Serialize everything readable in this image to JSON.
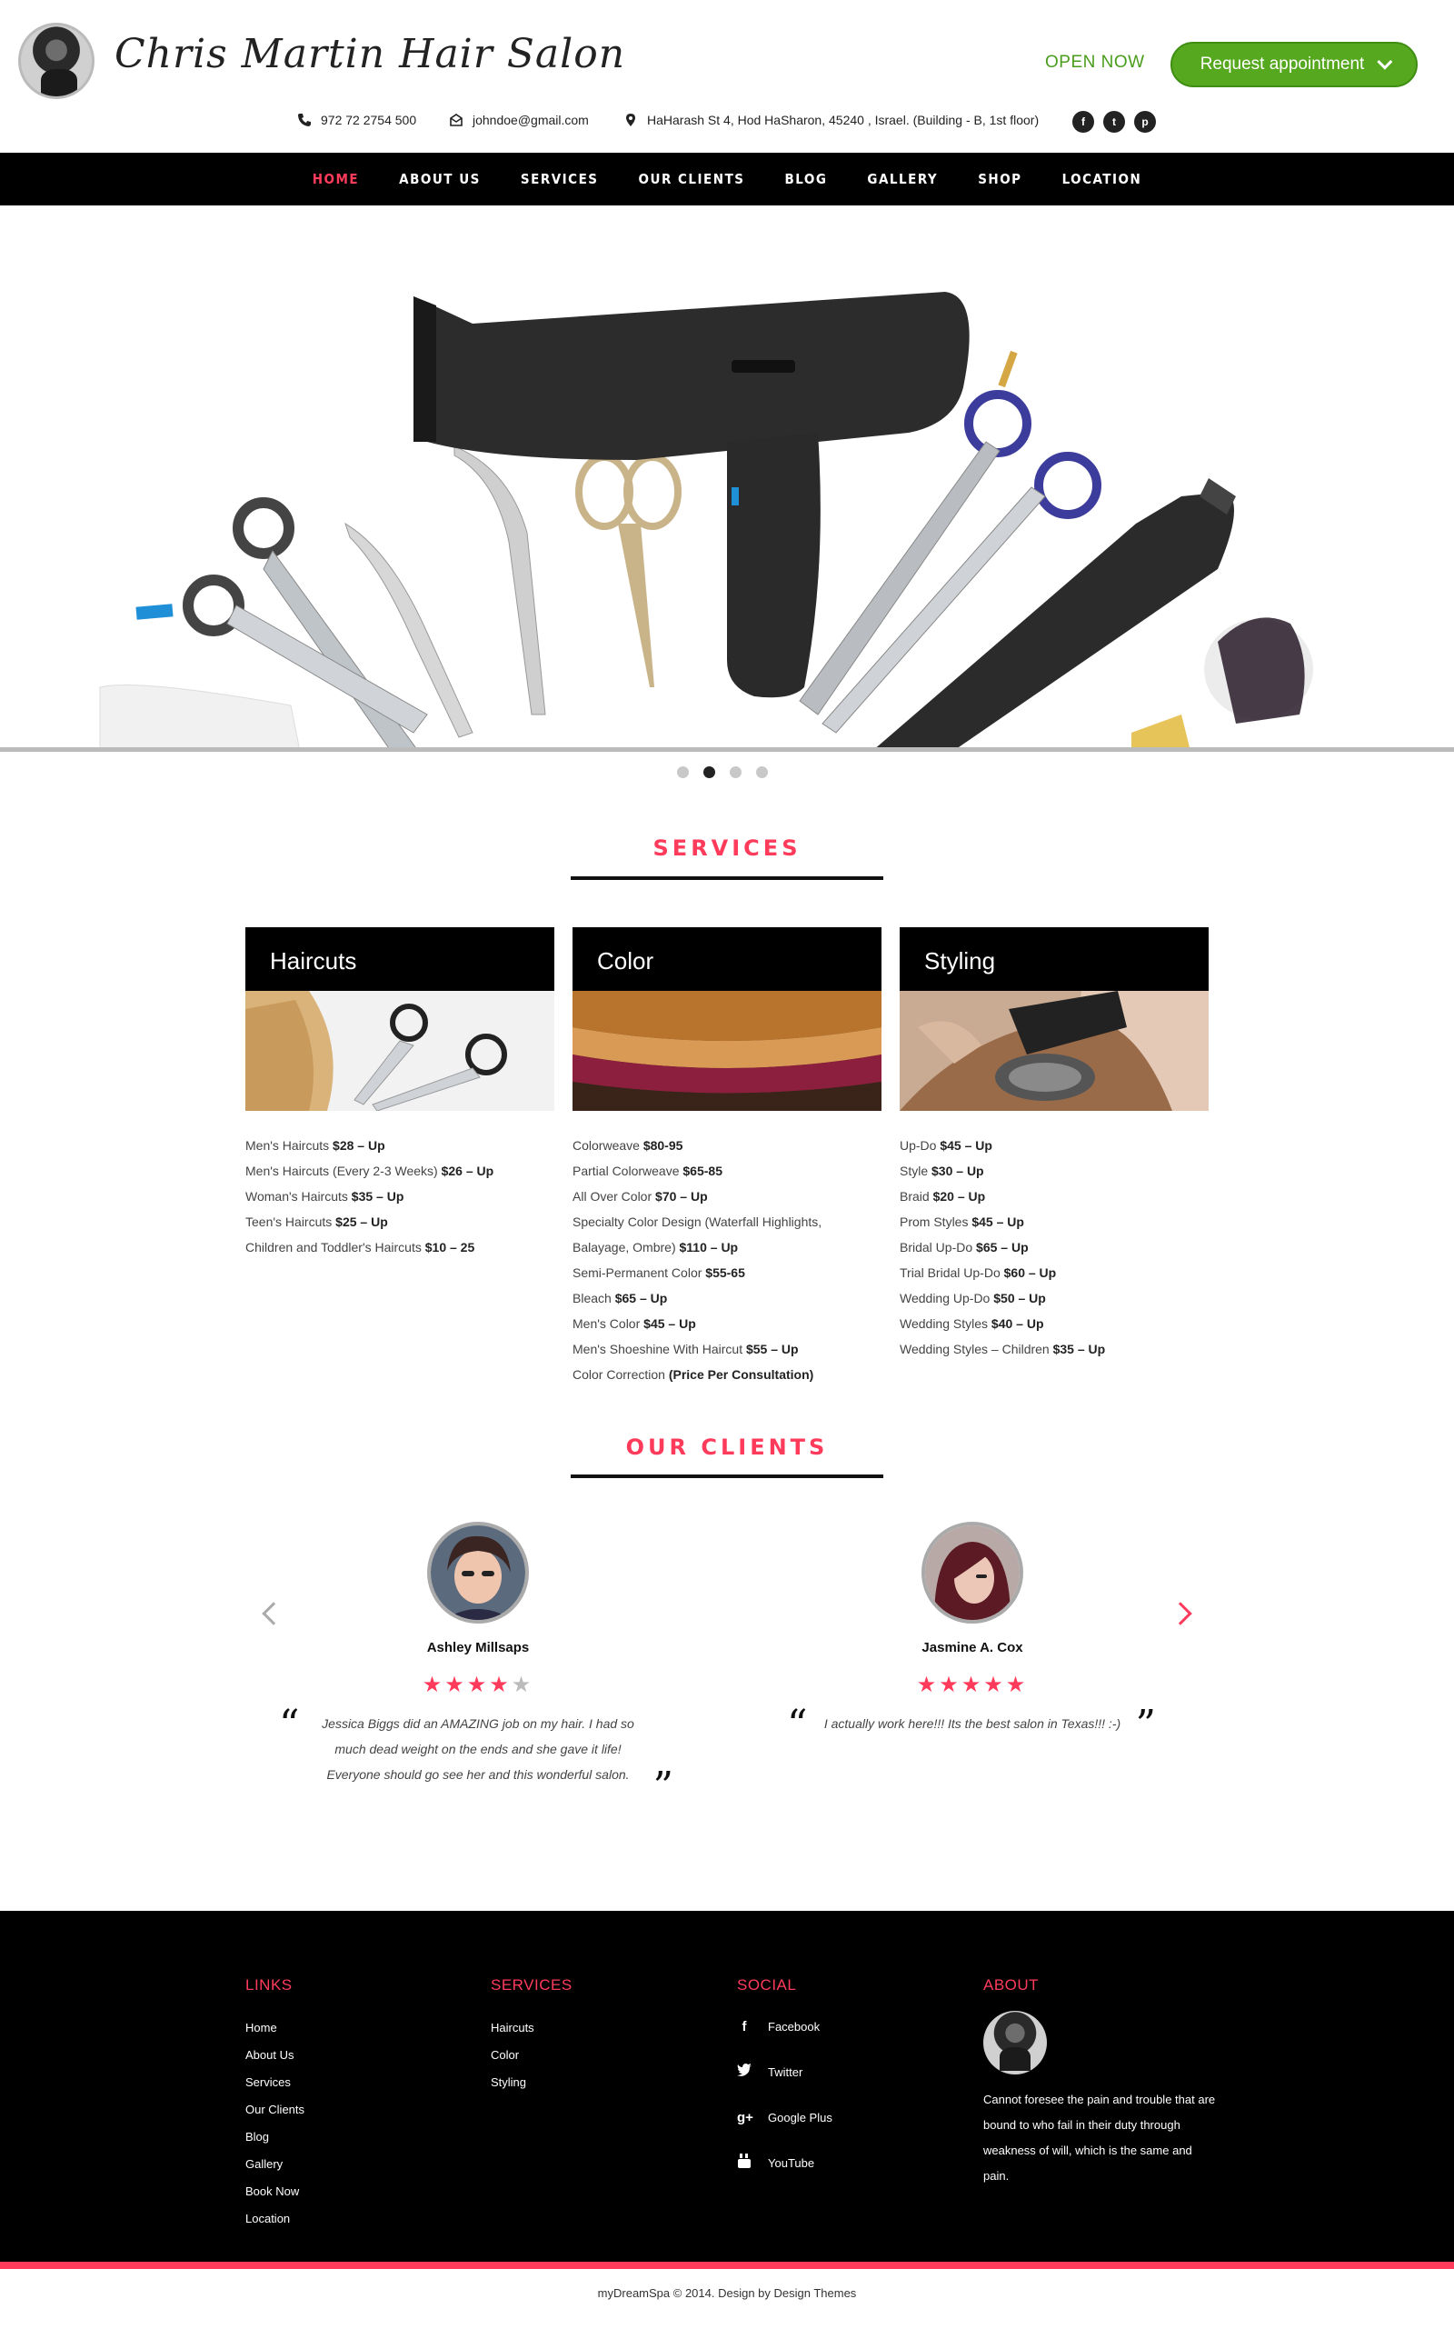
{
  "header": {
    "brand_title": "Chris Martin Hair Salon",
    "open_status": "OPEN NOW",
    "request_button": "Request appointment",
    "phone": "972 72 2754 500",
    "email": "johndoe@gmail.com",
    "address": "HaHarash St 4, Hod HaSharon, 45240 , Israel. (Building - B, 1st floor)",
    "social_icons": [
      "facebook-icon",
      "twitter-icon",
      "pinterest-icon"
    ],
    "accent_green": "#56a81f"
  },
  "nav": {
    "items": [
      {
        "label": "HOME",
        "active": true
      },
      {
        "label": "ABOUT US"
      },
      {
        "label": "SERVICES"
      },
      {
        "label": "OUR CLIENTS"
      },
      {
        "label": "BLOG"
      },
      {
        "label": "GALLERY"
      },
      {
        "label": "SHOP"
      },
      {
        "label": "LOCATION"
      }
    ],
    "accent": "#ff3b5c"
  },
  "slider": {
    "dots": 4,
    "active_dot": 2
  },
  "services": {
    "title": "SERVICES",
    "columns": [
      {
        "title": "Haircuts",
        "items": [
          {
            "name": "Men's Haircuts",
            "price": "$28 – Up"
          },
          {
            "name": "Men's Haircuts (Every 2-3 Weeks)",
            "price": "$26 – Up"
          },
          {
            "name": "Woman's Haircuts",
            "price": "$35 – Up"
          },
          {
            "name": "Teen's Haircuts",
            "price": "$25 – Up"
          },
          {
            "name": "Children and Toddler's Haircuts",
            "price": "$10 – 25"
          }
        ]
      },
      {
        "title": "Color",
        "items": [
          {
            "name": "Colorweave",
            "price": "$80-95"
          },
          {
            "name": "Partial Colorweave",
            "price": "$65-85"
          },
          {
            "name": "All Over Color",
            "price": "$70 – Up"
          },
          {
            "name": "Specialty Color Design (Waterfall Highlights,",
            "price": ""
          },
          {
            "name": "Balayage, Ombre)",
            "price": "$110 – Up"
          },
          {
            "name": "Semi-Permanent Color",
            "price": "$55-65"
          },
          {
            "name": "Bleach",
            "price": "$65 – Up"
          },
          {
            "name": "Men's Color",
            "price": "$45 – Up"
          },
          {
            "name": "Men's Shoeshine With Haircut",
            "price": "$55 – Up"
          },
          {
            "name": "Color Correction",
            "price": "(Price Per Consultation)"
          }
        ]
      },
      {
        "title": "Styling",
        "items": [
          {
            "name": "Up-Do",
            "price": "$45 – Up"
          },
          {
            "name": "Style",
            "price": "$30 – Up"
          },
          {
            "name": "Braid",
            "price": "$20 – Up"
          },
          {
            "name": "Prom Styles",
            "price": "$45 – Up"
          },
          {
            "name": "Bridal Up-Do",
            "price": "$65 – Up"
          },
          {
            "name": "Trial Bridal Up-Do",
            "price": "$60 – Up"
          },
          {
            "name": "Wedding Up-Do",
            "price": "$50 – Up"
          },
          {
            "name": "Wedding Styles",
            "price": "$40 – Up"
          },
          {
            "name": "Wedding Styles – Children",
            "price": "$35 – Up"
          }
        ]
      }
    ]
  },
  "clients": {
    "title": "OUR CLIENTS",
    "testimonials": [
      {
        "name": "Ashley Millsaps",
        "rating": 4,
        "quote": "Jessica Biggs did an AMAZING job on my hair. I had so much dead weight on the ends and she gave it life! Everyone should go see her and this wonderful salon."
      },
      {
        "name": "Jasmine A. Cox",
        "rating": 5,
        "quote": "I actually work here!!! Its the best salon in Texas!!! :-)"
      }
    ]
  },
  "footer": {
    "links_title": "LINKS",
    "links": [
      "Home",
      "About Us",
      "Services",
      "Our Clients",
      "Blog",
      "Gallery",
      "Book Now",
      "Location"
    ],
    "services_title": "SERVICES",
    "services": [
      "Haircuts",
      "Color",
      "Styling"
    ],
    "social_title": "SOCIAL",
    "social": [
      {
        "label": "Facebook",
        "icon": "facebook-icon"
      },
      {
        "label": "Twitter",
        "icon": "twitter-icon"
      },
      {
        "label": "Google Plus",
        "icon": "google-plus-icon"
      },
      {
        "label": "YouTube",
        "icon": "youtube-icon"
      }
    ],
    "about_title": "ABOUT",
    "about_text": "Cannot foresee the pain and trouble that are bound to who fail in their duty through weakness of will, which is the same and pain.",
    "copyright": "myDreamSpa © 2014. Design by Design Themes"
  }
}
